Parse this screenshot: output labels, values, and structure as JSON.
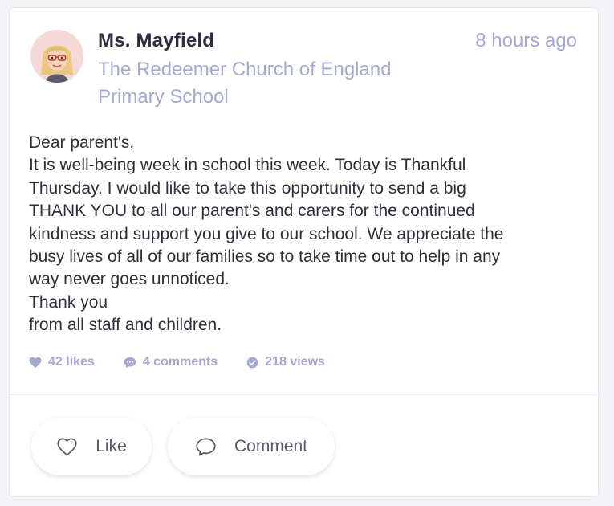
{
  "post": {
    "author": "Ms. Mayfield",
    "school_lines": [
      "The Redeemer Church of England",
      "Primary School"
    ],
    "time": "8 hours ago",
    "body_lines": [
      "Dear parent's,",
      "It is well-being week in school this week. Today is Thankful",
      "Thursday. I would like to take this opportunity to send a big",
      "THANK YOU to all our parent's and carers for the continued",
      "kindness and support you give to our school. We appreciate the",
      "busy lives of all of our families so to take time out to help in any",
      "way never goes unnoticed.",
      "Thank you",
      "from all staff and children."
    ]
  },
  "stats": {
    "likes": "42 likes",
    "comments": "4 comments",
    "views": "218 views"
  },
  "actions": {
    "like_label": "Like",
    "comment_label": "Comment"
  },
  "icons": {
    "likes": "heart-icon",
    "comments": "speech-bubble-icon",
    "views": "check-circle-icon",
    "like_button": "heart-outline-icon",
    "comment_button": "speech-bubble-outline-icon"
  },
  "colors": {
    "author": "#2b2d42",
    "muted_accent": "#a5a7d4",
    "body_text": "#2e2f3a",
    "button_text": "#55576a"
  }
}
